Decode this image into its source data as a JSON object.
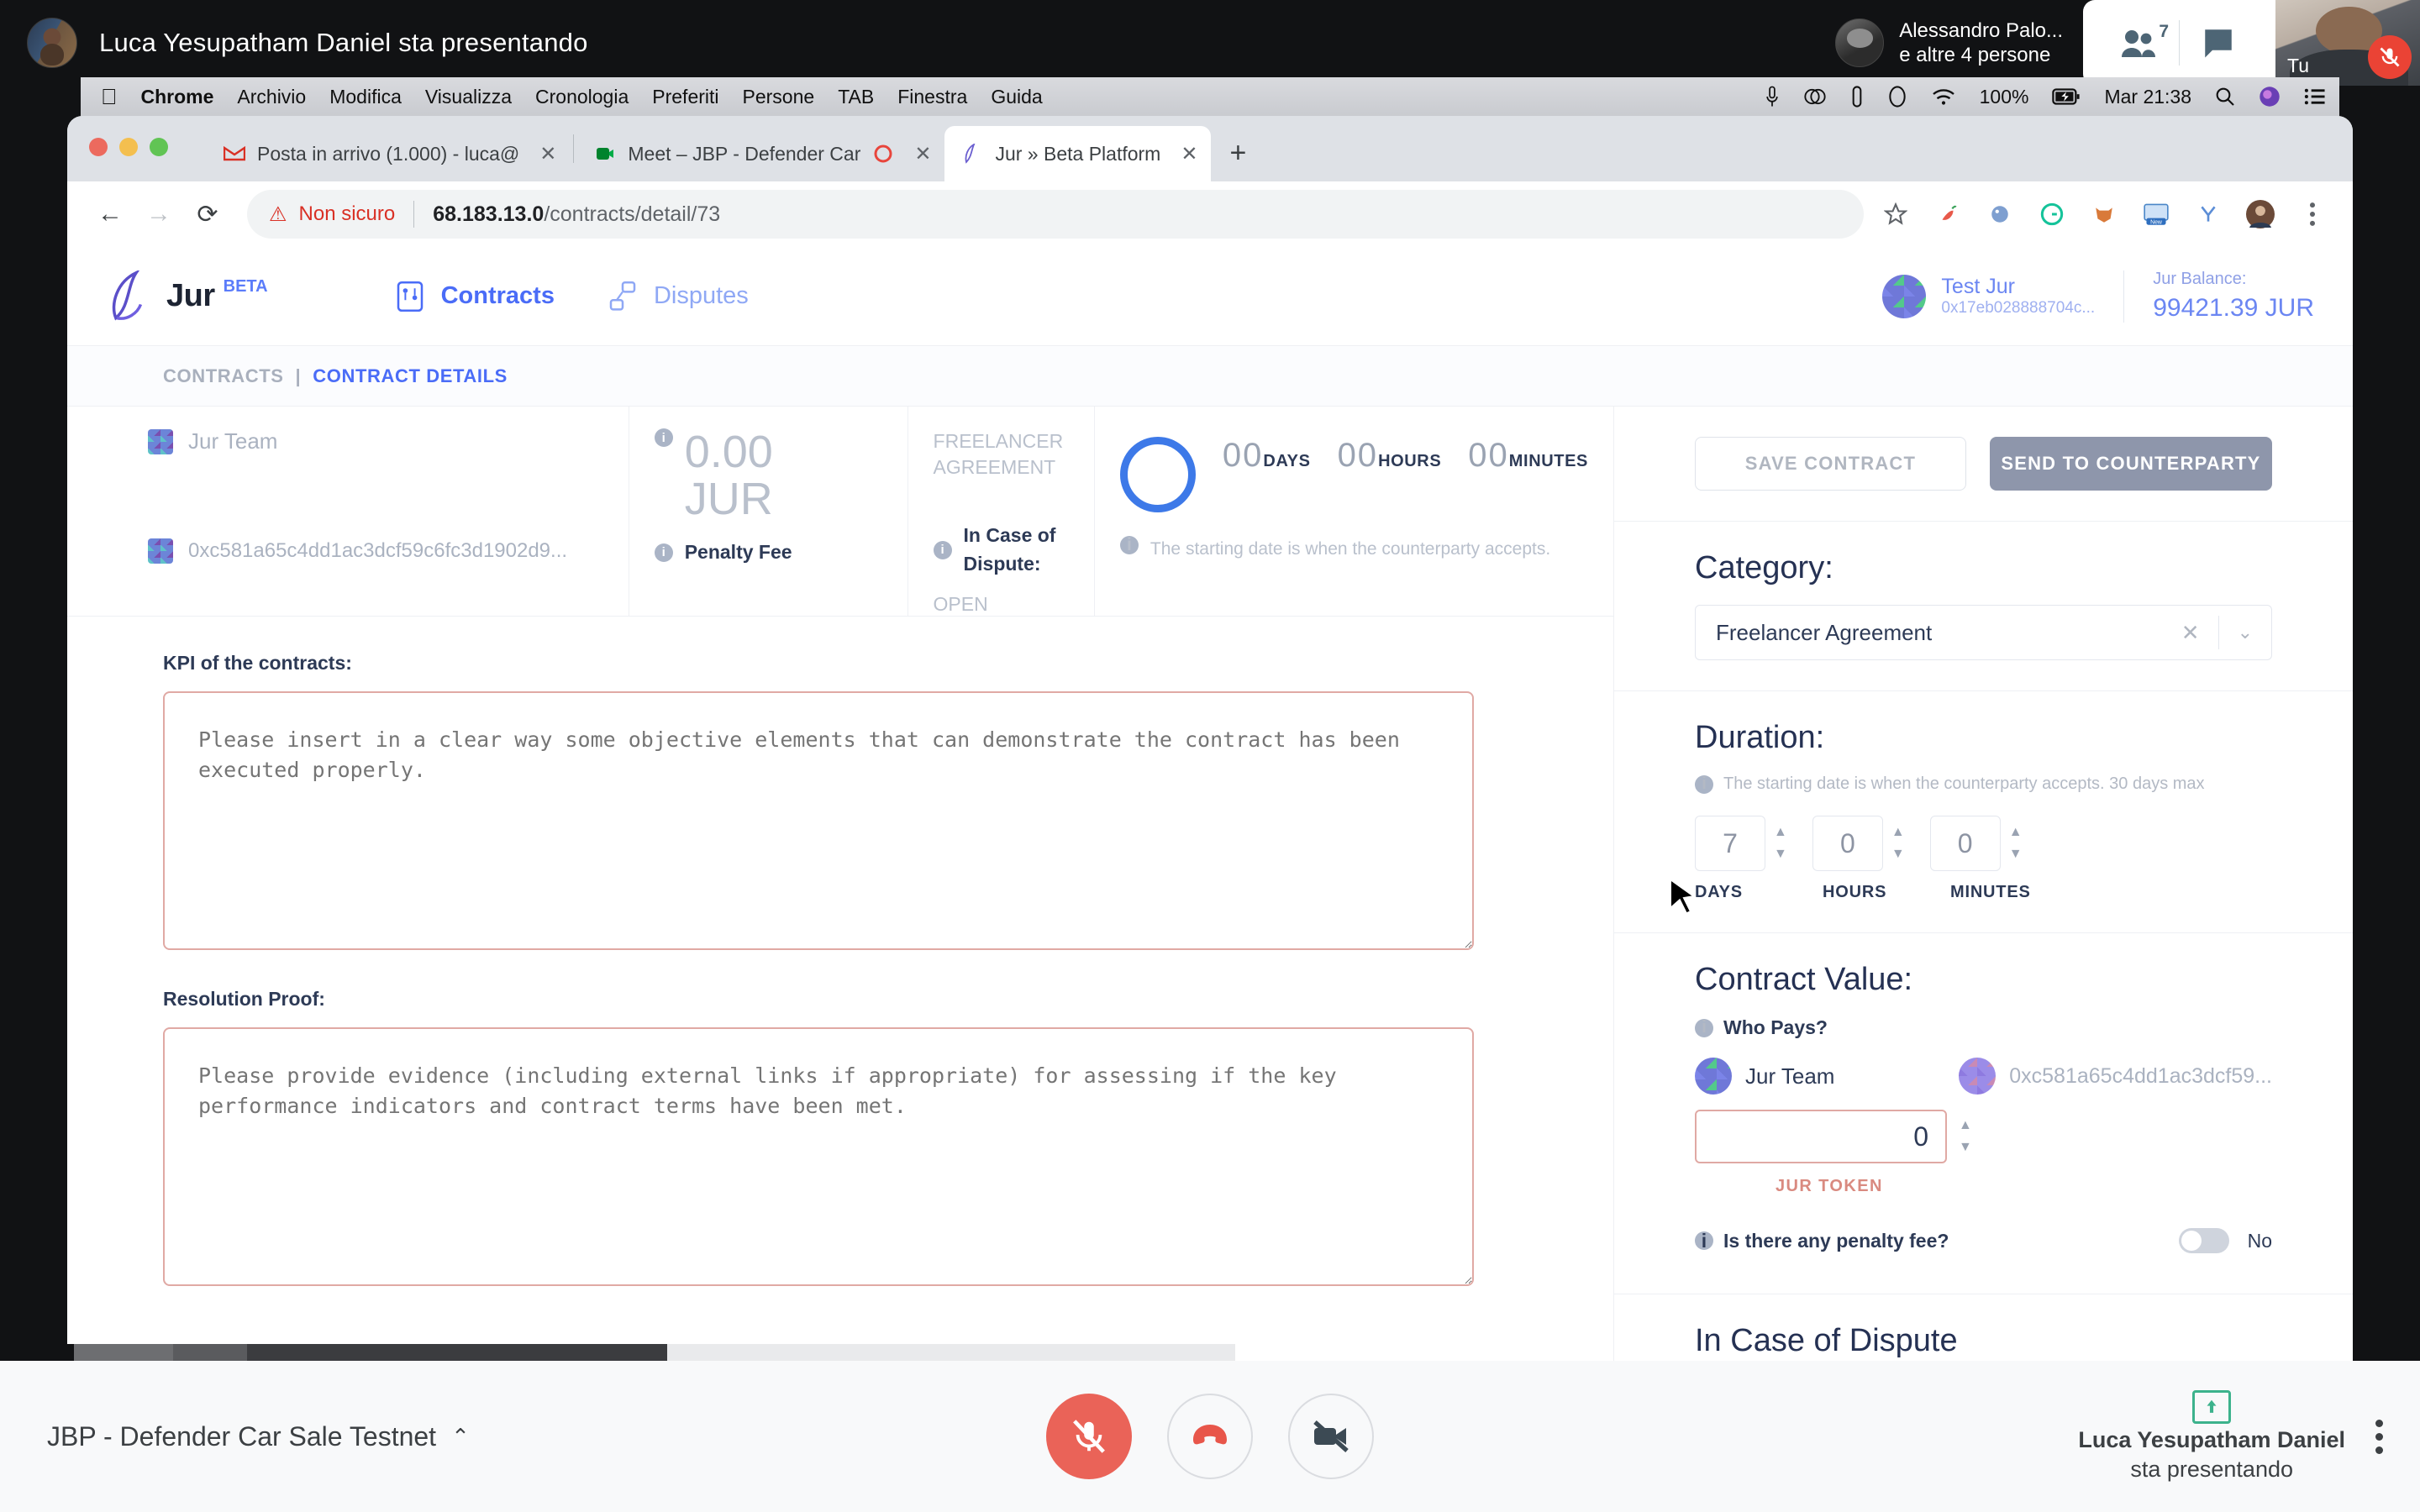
{
  "meet_top": {
    "presenting_title": "Luca Yesupatham Daniel sta presentando",
    "speaker_name": "Alessandro Palo...",
    "speaker_sub": "e altre 4 persone",
    "participants_count": "7",
    "people_icon": "people-icon",
    "chat_icon": "chat-icon",
    "self_label": "Tu",
    "mute_icon": "mic-off-icon"
  },
  "mac_menu": {
    "apple": "",
    "items": [
      "Chrome",
      "Archivio",
      "Modifica",
      "Visualizza",
      "Cronologia",
      "Preferiti",
      "Persone",
      "TAB",
      "Finestra",
      "Guida"
    ],
    "right": {
      "mic_icon": "microphone-icon",
      "adobe_icon": "adobe-cc-icon",
      "clipboard_icon": "clipboard-icon",
      "shield_icon": "shield-icon",
      "wifi_icon": "wifi-icon",
      "battery_pct": "100%",
      "battery_icon": "battery-charging-icon",
      "datetime": "Mar 21:38",
      "search_icon": "search-icon",
      "siri_icon": "siri-icon",
      "control_center_icon": "control-center-icon"
    }
  },
  "chrome": {
    "tabs": [
      {
        "title": "Posta in arrivo (1.000) - luca@",
        "favicon": "gmail-icon",
        "active": false
      },
      {
        "title": "Meet – JBP - Defender Car",
        "favicon": "meet-icon",
        "active": false
      },
      {
        "title": "Jur » Beta Platform",
        "favicon": "jur-icon",
        "active": true
      }
    ],
    "new_tab_label": "+",
    "close_label": "✕",
    "nav": {
      "back": "←",
      "forward": "→",
      "reload": "⟳"
    },
    "security_label": "Non sicuro",
    "url_host": "68.183.13.0",
    "url_path": "/contracts/detail/73",
    "omni_icons": [
      "star-icon",
      "extension-chili-icon",
      "extension-palette-icon",
      "extension-grammarly-icon",
      "extension-fox-icon",
      "extension-new-icon",
      "extension-y-icon",
      "profile-avatar-icon",
      "kebab-menu-icon"
    ]
  },
  "app": {
    "brand": {
      "name": "Jur",
      "beta": "BETA",
      "logo": "jur-sail-logo-icon"
    },
    "nav": [
      {
        "label": "Contracts",
        "icon": "contracts-icon",
        "active": true
      },
      {
        "label": "Disputes",
        "icon": "disputes-icon",
        "active": false
      }
    ],
    "account": {
      "name": "Test Jur",
      "address": "0x17eb028888704c...",
      "avatar": "blockie-avatar"
    },
    "balance": {
      "label": "Jur Balance:",
      "value": "99421.39 JUR"
    },
    "breadcrumb": {
      "parent": "CONTRACTS",
      "separator": "|",
      "current": "CONTRACT DETAILS"
    },
    "summary": {
      "party_name": "Jur Team",
      "party_address": "0xc581a65c4dd1ac3dcf59c6fc3d1902d9...",
      "amount": "0.00",
      "currency": "JUR",
      "penalty_label": "Penalty Fee",
      "category_value": "FREELANCER AGREEMENT",
      "dispute_label": "In Case of Dispute:",
      "dispute_value": "OPEN",
      "timer": [
        {
          "value": "00",
          "label": "DAYS"
        },
        {
          "value": "00",
          "label": "HOURS"
        },
        {
          "value": "00",
          "label": "MINUTES"
        }
      ],
      "starting_note": "The starting date is when the counterparty accepts."
    },
    "form": {
      "kpi_label": "KPI of the contracts:",
      "kpi_placeholder": "Please insert in a clear way some objective elements that can demonstrate the contract has been executed properly.",
      "proof_label": "Resolution Proof:",
      "proof_placeholder": "Please provide evidence (including external links if appropriate) for assessing if the key performance indicators and contract terms have been met."
    },
    "panel": {
      "save_label": "SAVE CONTRACT",
      "send_label": "SEND TO COUNTERPARTY",
      "category_title": "Category:",
      "category_value": "Freelancer Agreement",
      "category_clear": "✕",
      "category_caret": "⌄",
      "duration_title": "Duration:",
      "duration_hint": "The starting date is when the counterparty accepts. 30 days max",
      "duration": [
        {
          "value": "7",
          "label": "DAYS"
        },
        {
          "value": "0",
          "label": "HOURS"
        },
        {
          "value": "0",
          "label": "MINUTES"
        }
      ],
      "value_title": "Contract Value:",
      "who_pays_label": "Who Pays?",
      "payer_name": "Jur Team",
      "payee_address": "0xc581a65c4dd1ac3dcf59...",
      "amount_value": "0",
      "token_label": "JUR TOKEN",
      "penalty_question": "Is there any penalty fee?",
      "penalty_toggle_value": "No",
      "dispute_title": "In Case of Dispute"
    }
  },
  "meet_bottom": {
    "meeting_title": "JBP - Defender Car Sale Testnet",
    "caret": "⌃",
    "controls": [
      {
        "name": "mic-off-button",
        "icon": "mic-off-icon",
        "style": "red"
      },
      {
        "name": "hangup-button",
        "icon": "phone-hangup-icon",
        "style": "outline"
      },
      {
        "name": "camera-off-button",
        "icon": "camera-off-icon",
        "style": "outline"
      }
    ],
    "present_icon": "present-screen-icon",
    "presenter_name": "Luca Yesupatham Daniel",
    "presenter_sub": "sta presentando",
    "more_icon": "kebab-menu-icon"
  }
}
